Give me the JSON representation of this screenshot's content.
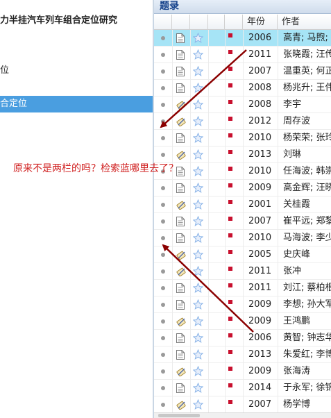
{
  "left_panel": {
    "items": [
      {
        "label": "力半挂汽车列车组合定位研究",
        "bold": true,
        "selected": false
      },
      {
        "label": "位",
        "bold": false,
        "selected": false
      },
      {
        "label": "合定位",
        "bold": false,
        "selected": true
      }
    ]
  },
  "right_panel": {
    "title": "题录",
    "columns": {
      "year": "年份",
      "author": "作者"
    },
    "rows": [
      {
        "type": "doc",
        "year": "2006",
        "author": "高青; 马煦; 梅",
        "selected": true
      },
      {
        "type": "doc",
        "year": "2011",
        "author": "张晓霞; 汪传",
        "selected": false
      },
      {
        "type": "doc",
        "year": "2007",
        "author": "温重英; 何正",
        "selected": false
      },
      {
        "type": "doc",
        "year": "2008",
        "author": "杨兆升; 王伟",
        "selected": false
      },
      {
        "type": "thesis",
        "year": "2008",
        "author": "李宇",
        "selected": false
      },
      {
        "type": "thesis",
        "year": "2012",
        "author": "周存波",
        "selected": false
      },
      {
        "type": "doc",
        "year": "2010",
        "author": "杨荣荣; 张玲",
        "selected": false
      },
      {
        "type": "thesis",
        "year": "2013",
        "author": "刘琳",
        "selected": false
      },
      {
        "type": "doc",
        "year": "2010",
        "author": "任海波; 韩崇",
        "selected": false
      },
      {
        "type": "doc",
        "year": "2009",
        "author": "高金辉; 汪晓",
        "selected": false
      },
      {
        "type": "thesis",
        "year": "2001",
        "author": "关桂霞",
        "selected": false
      },
      {
        "type": "doc",
        "year": "2007",
        "author": "崔平远; 郑黎",
        "selected": false
      },
      {
        "type": "doc",
        "year": "2010",
        "author": "马海波; 李少",
        "selected": false
      },
      {
        "type": "thesis",
        "year": "2005",
        "author": "史庆峰",
        "selected": false
      },
      {
        "type": "thesis",
        "year": "2011",
        "author": "张冲",
        "selected": false
      },
      {
        "type": "doc",
        "year": "2011",
        "author": "刘江; 蔡柏根",
        "selected": false
      },
      {
        "type": "doc",
        "year": "2009",
        "author": "李想; 孙大军",
        "selected": false
      },
      {
        "type": "thesis",
        "year": "2009",
        "author": "王鸿鹏",
        "selected": false
      },
      {
        "type": "doc",
        "year": "2006",
        "author": "黄智; 钟志华",
        "selected": false
      },
      {
        "type": "doc",
        "year": "2013",
        "author": "朱爱红; 李博",
        "selected": false
      },
      {
        "type": "thesis",
        "year": "2009",
        "author": "张海涛",
        "selected": false
      },
      {
        "type": "doc",
        "year": "2014",
        "author": "于永军; 徐锦",
        "selected": false
      },
      {
        "type": "thesis",
        "year": "2007",
        "author": "杨学博",
        "selected": false
      }
    ]
  },
  "annotation": {
    "text": "原来不是两栏的吗？检索蓝哪里去了？",
    "color": "#d02020",
    "arrow_color": "#8b0000"
  },
  "colors": {
    "selected_left": "#4a9ee0",
    "selected_row": "#a6e4f6",
    "flag": "#c8102e",
    "star": "#8ab4e8"
  }
}
